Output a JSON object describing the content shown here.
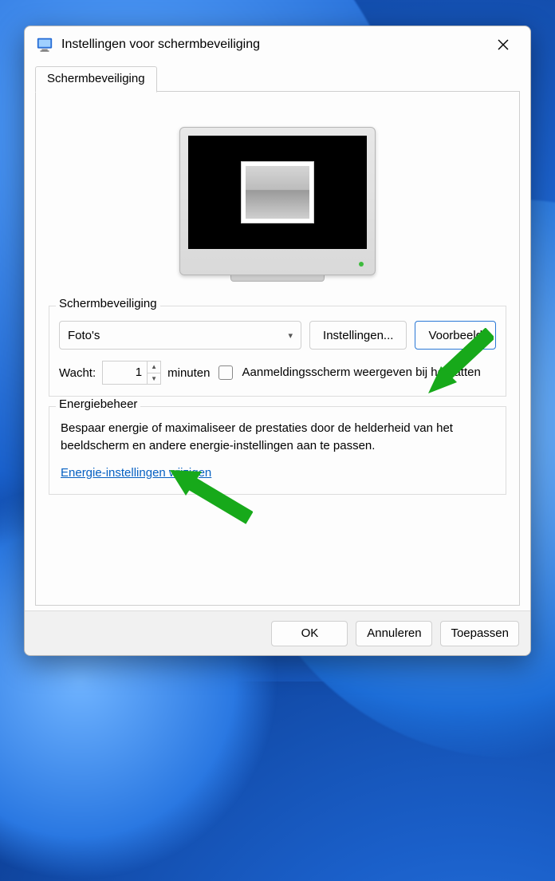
{
  "window": {
    "title": "Instellingen voor schermbeveiliging"
  },
  "tab": {
    "label": "Schermbeveiliging"
  },
  "screensaver": {
    "group_label": "Schermbeveiliging",
    "selected": "Foto's",
    "settings_button": "Instellingen...",
    "preview_button": "Voorbeeld",
    "wait_label": "Wacht:",
    "wait_value": "1",
    "wait_unit": "minuten",
    "resume_checkbox_label": "Aanmeldingsscherm weergeven bij hervatten"
  },
  "power": {
    "group_label": "Energiebeheer",
    "description": "Bespaar energie of maximaliseer de prestaties door de helderheid van het beeldscherm en andere energie-instellingen aan te passen.",
    "link": "Energie-instellingen wijzigen"
  },
  "footer": {
    "ok": "OK",
    "cancel": "Annuleren",
    "apply": "Toepassen"
  }
}
